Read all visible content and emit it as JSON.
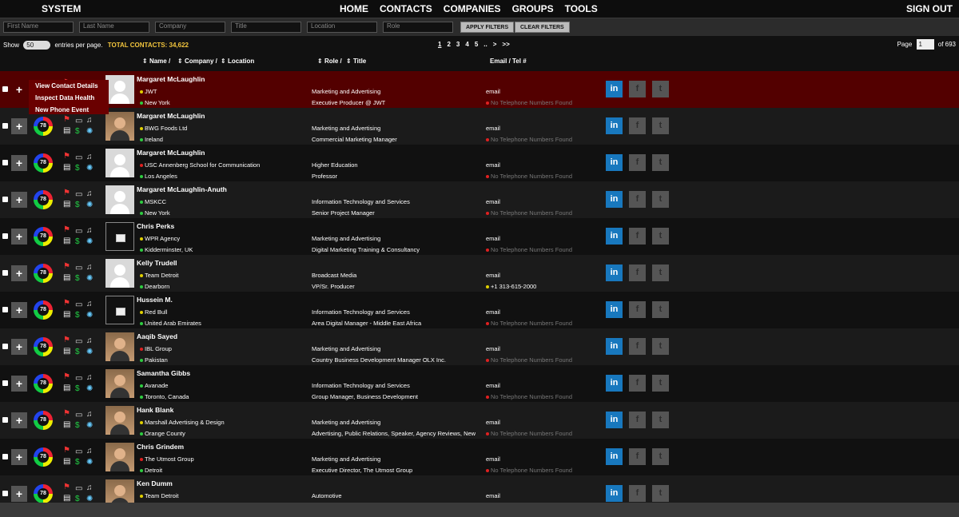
{
  "header": {
    "brand": "SYSTEM",
    "nav": [
      "HOME",
      "CONTACTS",
      "COMPANIES",
      "GROUPS",
      "TOOLS"
    ],
    "signout": "SIGN OUT"
  },
  "filters": {
    "placeholders": [
      "First Name",
      "Last Name",
      "Company",
      "Title",
      "Location",
      "Role"
    ],
    "apply": "APPLY FILTERS",
    "clear": "CLEAR FILTERS"
  },
  "info": {
    "show": "Show",
    "per_page": "50",
    "entries": "entries per page.",
    "total": "TOTAL CONTACTS: 34,622",
    "pages": [
      "1",
      "2",
      "3",
      "4",
      "5",
      "..",
      ">",
      ">>"
    ],
    "page_label": "Page",
    "page_value": "1",
    "of_pages": "of 693"
  },
  "columns": {
    "name": "Name /",
    "company": "Company /",
    "location": "Location",
    "role": "Role /",
    "title": "Title",
    "email": "Email / Tel #"
  },
  "popup": [
    "View Contact Details",
    "Inspect Data Health",
    "New Phone Event"
  ],
  "contacts": [
    {
      "name": "Margaret McLaughlin",
      "company": "JWT",
      "company_dot": "#e0d000",
      "location": "New York",
      "industry": "Marketing and Advertising",
      "title": "Executive Producer @ JWT",
      "email": "email",
      "tel": "No Telephone Numbers Found",
      "score": "78",
      "avatar": "placeholder"
    },
    {
      "name": "Margaret McLaughlin",
      "company": "BWG Foods Ltd",
      "company_dot": "#e0d000",
      "location": "Ireland",
      "industry": "Marketing and Advertising",
      "title": "Commercial Marketing Manager",
      "email": "email",
      "tel": "No Telephone Numbers Found",
      "score": "78",
      "avatar": "photo"
    },
    {
      "name": "Margaret McLaughlin",
      "company": "USC Annenberg School for Communication",
      "company_dot": "#e02020",
      "location": "Los Angeles",
      "industry": "Higher Education",
      "title": "Professor",
      "email": "email",
      "tel": "No Telephone Numbers Found",
      "score": "78",
      "avatar": "placeholder"
    },
    {
      "name": "Margaret McLaughlin-Anuth",
      "company": "MSKCC",
      "company_dot": "#2ecc40",
      "location": "New York",
      "industry": "Information Technology and Services",
      "title": "Senior Project Manager",
      "email": "email",
      "tel": "No Telephone Numbers Found",
      "score": "78",
      "avatar": "placeholder"
    },
    {
      "name": "Chris Perks",
      "company": "WPR Agency",
      "company_dot": "#e0d000",
      "location": "Kidderminster, UK",
      "industry": "Marketing and Advertising",
      "title": "Digital Marketing Training & Consultancy",
      "email": "email",
      "tel": "No Telephone Numbers Found",
      "score": "78",
      "avatar": "broken"
    },
    {
      "name": "Kelly Trudell",
      "company": "Team Detroit",
      "company_dot": "#e0d000",
      "location": "Dearborn",
      "industry": "Broadcast Media",
      "title": "VP/Sr. Producer",
      "email": "email",
      "tel": "+1 313-615-2000",
      "score": "78",
      "avatar": "placeholder",
      "tel_found": true
    },
    {
      "name": "Hussein M.",
      "company": "Red Bull",
      "company_dot": "#e0d000",
      "location": "United Arab Emirates",
      "industry": "Information Technology and Services",
      "title": "Area Digital Manager - Middle East Africa",
      "email": "email",
      "tel": "No Telephone Numbers Found",
      "score": "78",
      "avatar": "broken"
    },
    {
      "name": "Aaqib Sayed",
      "company": "IBL Group",
      "company_dot": "#e02020",
      "location": "Pakistan",
      "industry": "Marketing and Advertising",
      "title": "Country Business Development Manager OLX Inc.",
      "email": "email",
      "tel": "No Telephone Numbers Found",
      "score": "78",
      "avatar": "photo"
    },
    {
      "name": "Samantha Gibbs",
      "company": "Avanade",
      "company_dot": "#2ecc40",
      "location": "Toronto, Canada",
      "industry": "Information Technology and Services",
      "title": "Group Manager, Business Development",
      "email": "email",
      "tel": "No Telephone Numbers Found",
      "score": "78",
      "avatar": "photo"
    },
    {
      "name": "Hank Blank",
      "company": "Marshall Advertising & Design",
      "company_dot": "#e0d000",
      "location": "Orange County",
      "industry": "Marketing and Advertising",
      "title": "Advertising, Public Relations, Speaker, Agency Reviews, New",
      "email": "email",
      "tel": "No Telephone Numbers Found",
      "score": "78",
      "avatar": "photo"
    },
    {
      "name": "Chris Grindem",
      "company": "The Utmost Group",
      "company_dot": "#e02020",
      "location": "Detroit",
      "industry": "Marketing and Advertising",
      "title": "Executive Director, The Utmost Group",
      "email": "email",
      "tel": "No Telephone Numbers Found",
      "score": "78",
      "avatar": "photo"
    },
    {
      "name": "Ken Dumm",
      "company": "Team Detroit",
      "company_dot": "#e0d000",
      "location": "",
      "industry": "Automotive",
      "title": "",
      "email": "email",
      "tel": "",
      "score": "78",
      "avatar": "photo"
    }
  ],
  "social": {
    "linkedin": "in",
    "facebook": "f",
    "twitter": "t"
  }
}
